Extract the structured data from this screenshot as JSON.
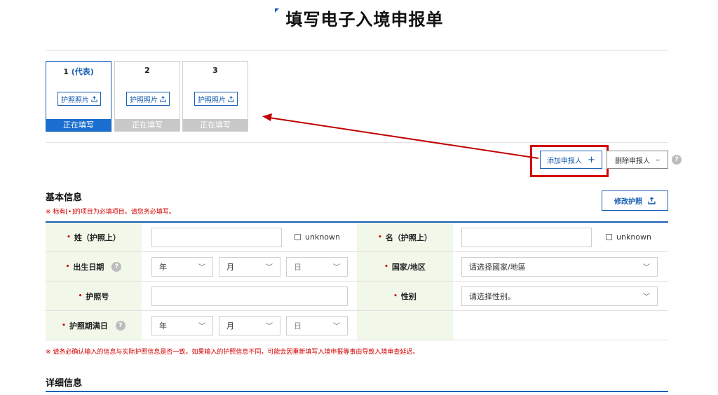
{
  "page": {
    "title": "填写电子入境申报单"
  },
  "applicants": [
    {
      "num": "1",
      "rep": "(代表)",
      "passport_label": "护照照片",
      "status": "正在填写",
      "active": true
    },
    {
      "num": "2",
      "rep": "",
      "passport_label": "护照照片",
      "status": "正在填写",
      "active": false
    },
    {
      "num": "3",
      "rep": "",
      "passport_label": "护照照片",
      "status": "正在填写",
      "active": false
    }
  ],
  "actions": {
    "add_label": "添加申报人",
    "add_symbol": "+",
    "delete_label": "删除申报人",
    "delete_symbol": "–",
    "help": "?"
  },
  "basic": {
    "title": "基本信息",
    "note": "※ 标有[•]的项目为必填项目。请您务必填写。",
    "edit_passport": "修改护照",
    "required_mark": "•",
    "surname": "姓（护照上）",
    "given_name": "名（护照上）",
    "unknown": "unknown",
    "birth_date": "出生日期",
    "year": "年",
    "month": "月",
    "day": "日",
    "country": "国家/地区",
    "country_placeholder": "请选择國家/地區",
    "passport_no": "护照号",
    "gender": "性别",
    "gender_placeholder": "请选择性别。",
    "expiry": "护照期满日"
  },
  "warning": "※ 请务必确认输入的信息与实际护照信息是否一致。如果输入的护照信息不同，可能会因重新填写入境申报等事由导致入境审查延迟。",
  "detail": {
    "title": "详细信息"
  },
  "colors": {
    "brand": "#1a5fb4",
    "highlight": "#d40000",
    "label_bg": "#f1f8ea"
  }
}
